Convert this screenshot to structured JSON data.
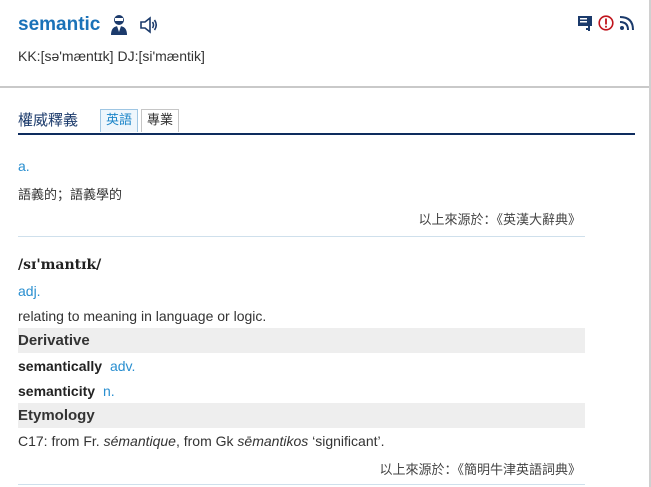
{
  "header": {
    "word": "semantic",
    "phonetics": "KK:[sə'mæntɪk] DJ:[si'mæntik]",
    "icons": [
      "person-icon",
      "speaker-icon",
      "bookmark-icon",
      "alert-icon",
      "rss-icon"
    ]
  },
  "tabs": {
    "title": "權威釋義",
    "items": [
      {
        "label": "英語",
        "active": true
      },
      {
        "label": "專業",
        "active": false
      }
    ]
  },
  "section1": {
    "pos": "a.",
    "definition": "語義的；語義學的",
    "source": "以上來源於：《英漢大辭典》"
  },
  "section2": {
    "phonetic": "/sɪ'mantɪk/",
    "pos": "adj.",
    "definition": "relating to meaning in language or logic.",
    "derivative_label": "Derivative",
    "derivatives": [
      {
        "word": "semantically",
        "pos": "adv."
      },
      {
        "word": "semanticity",
        "pos": "n."
      }
    ],
    "etymology_label": "Etymology",
    "etymology": {
      "prefix": "C17: from Fr. ",
      "fr_word": "sémantique",
      "middle": ", from Gk ",
      "gk_word": "sēmantikos",
      "suffix": " ‘significant’."
    },
    "source": "以上來源於：《簡明牛津英語詞典》"
  },
  "colors": {
    "accent": "#1a72b8",
    "pos_blue": "#2a8fd0",
    "tab_underline": "#0e2c5e",
    "band_bg": "#eeeeee"
  }
}
